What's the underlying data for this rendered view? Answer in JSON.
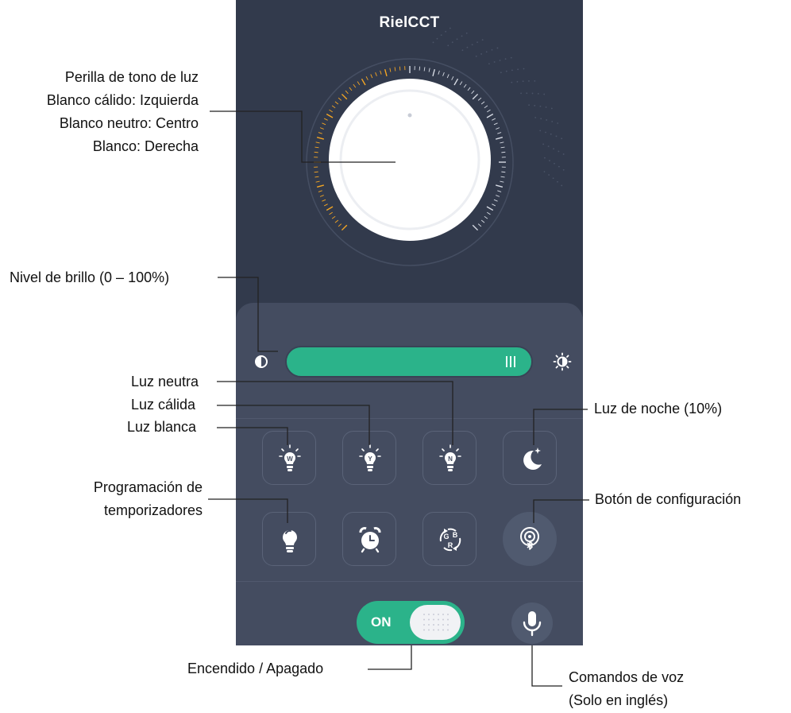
{
  "app": {
    "title": "RielCCT"
  },
  "controls": {
    "toggle_label": "ON",
    "dial_icon": "color-tone-dial",
    "brightness_icons": [
      "brightness-low-icon",
      "brightness-high-icon"
    ],
    "row1": [
      {
        "name": "white-light-bulb-icon",
        "letter": "W"
      },
      {
        "name": "warm-light-bulb-icon",
        "letter": "Y"
      },
      {
        "name": "neutral-light-bulb-icon",
        "letter": "N"
      },
      {
        "name": "moon-icon",
        "letter": ""
      }
    ],
    "row2": [
      {
        "name": "bulb-icon"
      },
      {
        "name": "alarm-clock-icon"
      },
      {
        "name": "rgb-cycle-icon",
        "letters": [
          "G",
          "B",
          "R"
        ]
      },
      {
        "name": "bluetooth-settings-icon"
      }
    ],
    "mic_icon": "microphone-icon",
    "accent_color": "#2bb38a",
    "dial_indicator_color": "#f5a623"
  },
  "annotations": {
    "dial": [
      "Perilla de tono de luz",
      "Blanco cálido: Izquierda",
      "Blanco neutro: Centro",
      "Blanco: Derecha"
    ],
    "brightness": "Nivel de brillo (0 – 100%)",
    "neutral": "Luz neutra",
    "warm": "Luz cálida",
    "white": "Luz blanca",
    "night": "Luz de noche (10%)",
    "timers": [
      "Programación de",
      "temporizadores"
    ],
    "settings": "Botón de configuración",
    "power": "Encendido / Apagado",
    "voice": [
      "Comandos de voz",
      "(Solo en inglés)"
    ]
  }
}
